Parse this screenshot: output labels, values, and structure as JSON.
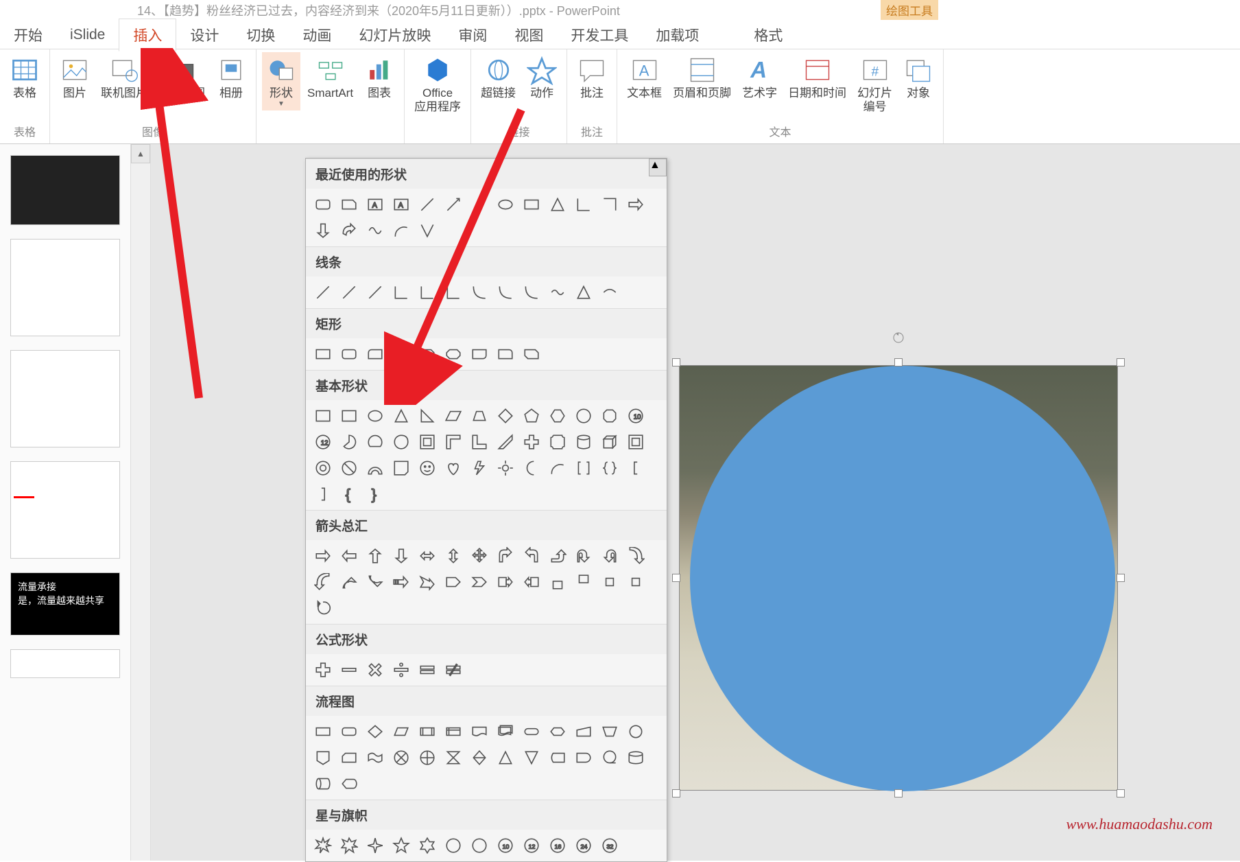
{
  "title": {
    "prefix": "14、【趋势】粉丝经济已过去，内容经济到来（2020年5月11日更新））.pptx",
    "app": "PowerPoint",
    "drawing_tools": "绘图工具"
  },
  "tabs": {
    "start": "开始",
    "islide": "iSlide",
    "insert": "插入",
    "design": "设计",
    "transition": "切换",
    "animation": "动画",
    "slideshow": "幻灯片放映",
    "review": "审阅",
    "view": "视图",
    "developer": "开发工具",
    "addins": "加载项",
    "format": "格式"
  },
  "ribbon": {
    "table": "表格",
    "picture": "图片",
    "online_picture": "联机图片",
    "screenshot": "屏幕截图",
    "album": "相册",
    "shapes": "形状",
    "smartart": "SmartArt",
    "chart": "图表",
    "office_apps": "Office\n应用程序",
    "hyperlink": "超链接",
    "action": "动作",
    "comment": "批注",
    "textbox": "文本框",
    "header_footer": "页眉和页脚",
    "wordart": "艺术字",
    "datetime": "日期和时间",
    "slide_number": "幻灯片\n编号",
    "object": "对象",
    "group_tables": "表格",
    "group_images": "图像",
    "group_links": "链接",
    "group_comments": "批注",
    "group_text": "文本"
  },
  "shapes_dropdown": {
    "recent": "最近使用的形状",
    "lines": "线条",
    "rectangles": "矩形",
    "basic_shapes": "基本形状",
    "block_arrows": "箭头总汇",
    "equation_shapes": "公式形状",
    "flowchart": "流程图",
    "stars_banners": "星与旗帜"
  },
  "slide_content": {
    "thumb5_line1": "流量承接",
    "thumb5_line2": "是，流量越来越共享"
  },
  "watermark": "www.huamaodashu.com",
  "colors": {
    "accent_orange": "#d24726",
    "highlight_bg": "#fce4d6",
    "circle_blue": "#5b9bd5",
    "arrow_red": "#e81e25"
  }
}
